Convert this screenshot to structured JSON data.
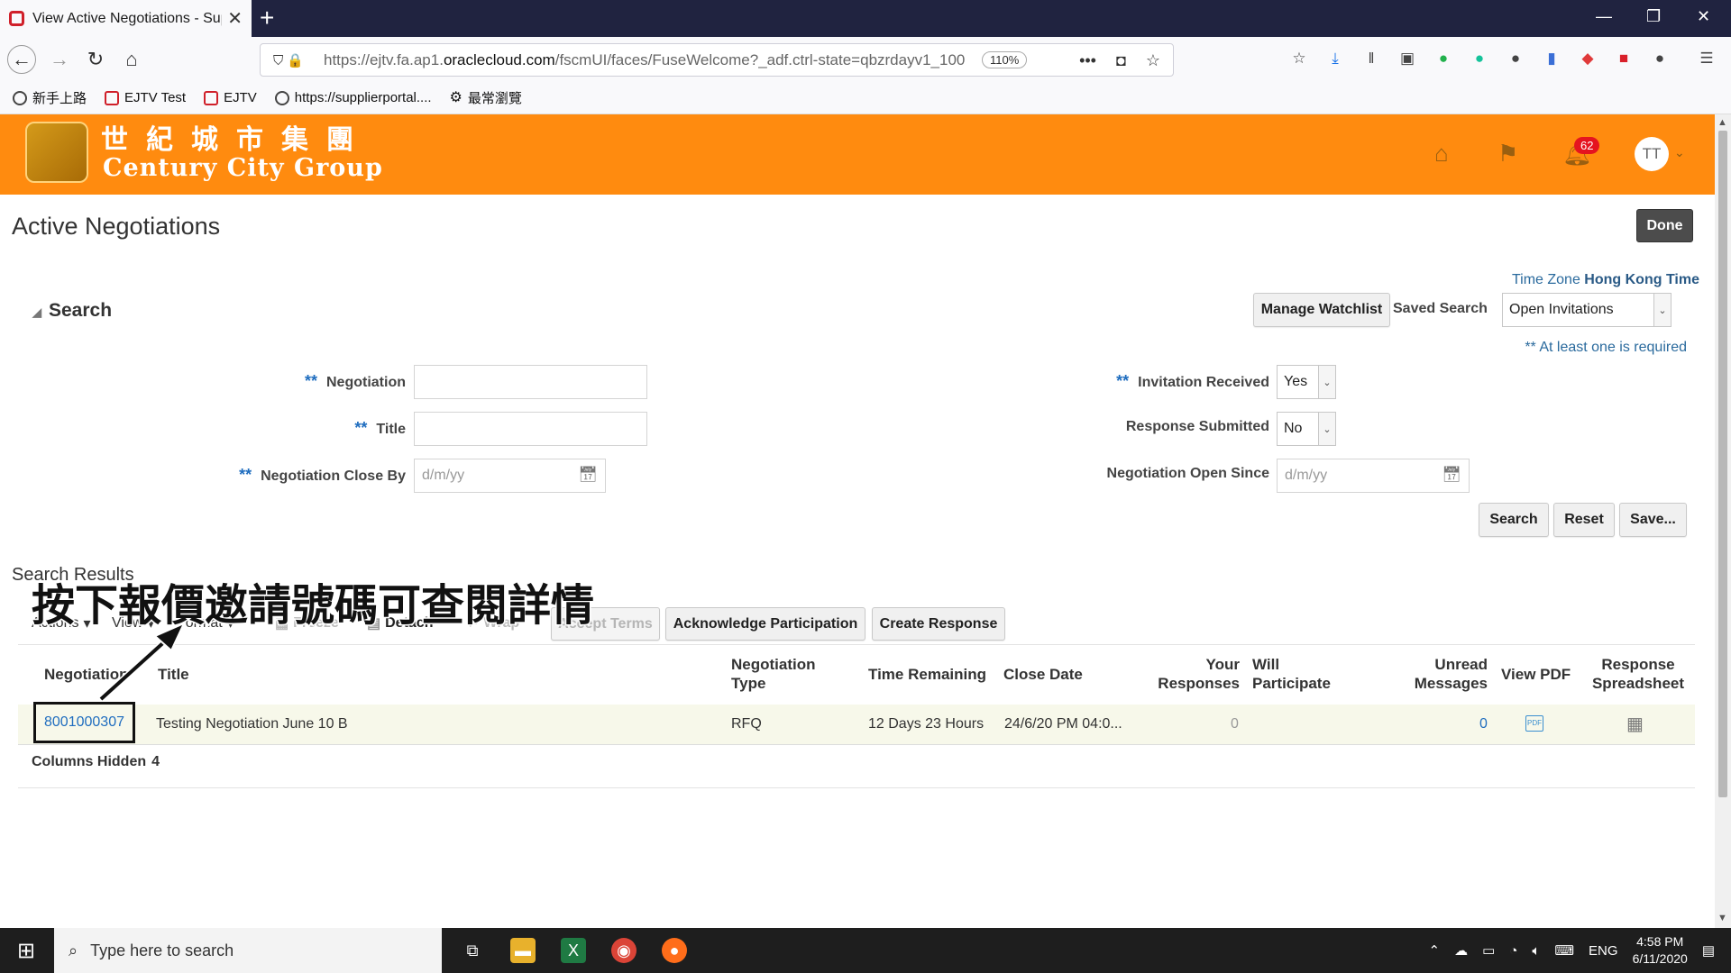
{
  "browser": {
    "tab_title": "View Active Negotiations - Sup",
    "new_tab": "+",
    "url_prefix": "https://ejtv.fa.ap1.",
    "url_domain": "oraclecloud.com",
    "url_path": "/fscmUI/faces/FuseWelcome?_adf.ctrl-state=qbzrdayv1_100",
    "zoom": "110%",
    "bookmarks": [
      "新手上路",
      "EJTV Test",
      "EJTV",
      "https://supplierportal....",
      "最常瀏覽"
    ]
  },
  "header": {
    "logo_cn": "世紀城市集團",
    "logo_en": "Century City Group",
    "notification_count": "62",
    "avatar_initials": "TT"
  },
  "page": {
    "title": "Active Negotiations",
    "done_label": "Done",
    "timezone_label": "Time Zone",
    "timezone_value": "Hong Kong Time"
  },
  "search": {
    "heading": "Search",
    "manage_watchlist": "Manage Watchlist",
    "saved_search_label": "Saved Search",
    "saved_search_value": "Open Invitations",
    "required_note": "** At least one is required",
    "req_marker": "**",
    "negotiation_label": "Negotiation",
    "title_label": "Title",
    "close_by_label": "Negotiation Close By",
    "date_placeholder": "d/m/yy",
    "invitation_received_label": "Invitation Received",
    "invitation_received_value": "Yes",
    "response_submitted_label": "Response Submitted",
    "response_submitted_value": "No",
    "open_since_label": "Negotiation Open Since",
    "search_btn": "Search",
    "reset_btn": "Reset",
    "save_btn": "Save..."
  },
  "results": {
    "title": "Search Results",
    "overlay_instruction": "按下報價邀請號碼可查閱詳情",
    "toolbar": {
      "actions": "Actions",
      "view": "View",
      "format": "Format",
      "freeze": "Freeze",
      "detach": "Detach",
      "wrap": "Wrap",
      "accept_terms": "Accept Terms",
      "acknowledge": "Acknowledge Participation",
      "create_response": "Create Response"
    },
    "columns": {
      "negotiation": "Negotiation",
      "title": "Title",
      "type_l1": "Negotiation",
      "type_l2": "Type",
      "time_remaining": "Time Remaining",
      "close_date": "Close Date",
      "your_responses_l1": "Your",
      "your_responses_l2": "Responses",
      "will_l1": "Will",
      "will_l2": "Participate",
      "unread_l1": "Unread",
      "unread_l2": "Messages",
      "view_pdf": "View PDF",
      "spreadsheet_l1": "Response",
      "spreadsheet_l2": "Spreadsheet"
    },
    "rows": [
      {
        "negotiation": "8001000307",
        "title": "Testing Negotiation June 10 B",
        "type": "RFQ",
        "time_remaining": "12 Days 23 Hours",
        "close_date": "24/6/20 PM 04:0...",
        "your_responses": "0",
        "will_participate": "",
        "unread_messages": "0"
      }
    ],
    "columns_hidden_label": "Columns Hidden",
    "columns_hidden_count": "4"
  },
  "taskbar": {
    "search_placeholder": "Type here to search",
    "lang": "ENG",
    "time": "4:58 PM",
    "date": "6/11/2020"
  },
  "colors": {
    "brand_orange": "#ff8b0f",
    "link_blue": "#1f6dbf",
    "tab_bar": "#202340"
  }
}
